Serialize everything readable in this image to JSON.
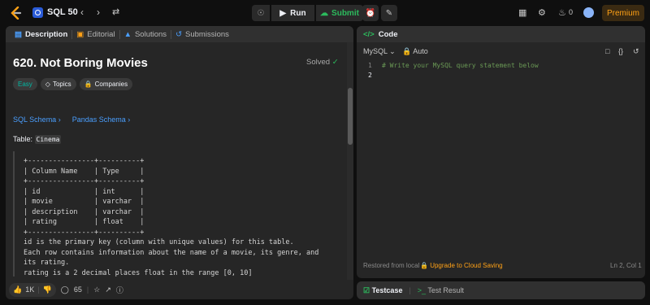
{
  "topbar": {
    "list_title": "SQL 50",
    "run_label": "Run",
    "submit_label": "Submit",
    "streak_count": "0",
    "premium_label": "Premium"
  },
  "tabs": {
    "description": "Description",
    "editorial": "Editorial",
    "solutions": "Solutions",
    "submissions": "Submissions"
  },
  "problem": {
    "title": "620. Not Boring Movies",
    "status": "Solved",
    "difficulty": "Easy",
    "topics_label": "Topics",
    "companies_label": "Companies",
    "link_sql": "SQL Schema",
    "link_pandas": "Pandas Schema",
    "table_prefix": "Table:",
    "table_name": "Cinema",
    "schema_text": "+----------------+----------+\n| Column Name    | Type     |\n+----------------+----------+\n| id             | int      |\n| movie          | varchar  |\n| description    | varchar  |\n| rating         | float    |\n+----------------+----------+\nid is the primary key (column with unique values) for this table.\nEach row contains information about the name of a movie, its genre, and\nits rating.\nrating is a 2 decimal places float in the range [0, 10]"
  },
  "footer": {
    "likes": "1K",
    "comments": "65"
  },
  "code": {
    "header": "Code",
    "language": "MySQL",
    "mode": "Auto",
    "lines": [
      "1",
      "2"
    ],
    "line1": "# Write your MySQL query statement below",
    "restored": "Restored from local",
    "upgrade": "Upgrade to Cloud Saving",
    "cursor": "Ln 2, Col 1"
  },
  "bottom_tabs": {
    "testcase": "Testcase",
    "result": "Test Result"
  },
  "colors": {
    "accent_green": "#2cbb5d",
    "premium": "#ffa116",
    "link": "#4a9fff",
    "easy": "#00b8a3"
  }
}
